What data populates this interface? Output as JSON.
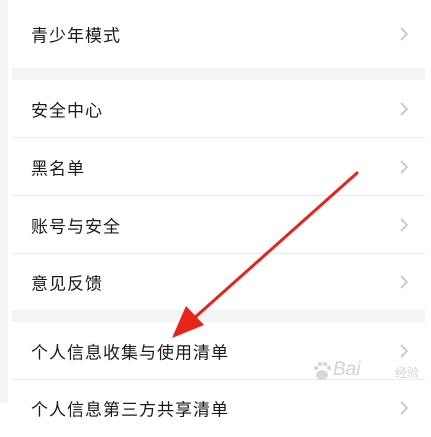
{
  "settings": {
    "items": [
      {
        "label": "青少年模式"
      },
      {
        "label": "安全中心"
      },
      {
        "label": "黑名单"
      },
      {
        "label": "账号与安全"
      },
      {
        "label": "意见反馈"
      },
      {
        "label": "个人信息收集与使用清单"
      },
      {
        "label": "个人信息第三方共享清单"
      }
    ]
  },
  "annotation": {
    "arrow_color": "#e8231b"
  },
  "watermark": {
    "brand": "Bai",
    "sub": "经验"
  }
}
